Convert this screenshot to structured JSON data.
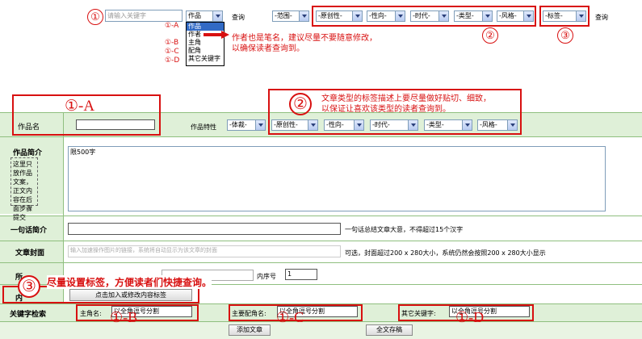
{
  "top_bar": {
    "search_placeholder": "请输入关键字",
    "type_select": "作品",
    "search_button": "查询",
    "scope_select": "-范围-",
    "filters": [
      "-原创性-",
      "-性向-",
      "-时代-",
      "-类型-",
      "-风格-"
    ],
    "tag_select": "-标签-",
    "search_button_2": "查询"
  },
  "dropdown": {
    "items": [
      "作品",
      "作者",
      "主角",
      "配角",
      "其它关键字"
    ],
    "side_labels": [
      "①-A",
      "①-B",
      "①-C",
      "①-D"
    ]
  },
  "annotations": {
    "num1": "①",
    "num2": "②",
    "num3": "③",
    "author_note_1": "作者也是笔名，建议尽量不要随意修改，",
    "author_note_2": "以确保读者查询到。",
    "big_a": "①-A",
    "big_num2": "②",
    "genre_note_1": "文章类型的标签描述上要尽量做好贴切、细致，",
    "genre_note_2": "以保证让喜欢该类型的读者查询到。",
    "big_num3": "③",
    "tag_note": "尽量设置标签，方便读者们快捷查询。",
    "label_b": "①-B",
    "label_c": "①-C",
    "label_d": "①-D"
  },
  "form": {
    "title_label": "作品名",
    "features_label": "作品特性",
    "feature_selects": [
      "-体裁-",
      "-原创性-",
      "-性向-",
      "-时代-",
      "-类型-",
      "-风格-"
    ],
    "intro_label": "作品简介",
    "intro_side_note": "这里只放作品文案，正文内容在后面步骤提交",
    "intro_placeholder": "限500字",
    "oneline_label": "一句话简介",
    "oneline_hint": "一句话总结文章大意，不得超过15个汉字",
    "cover_label": "文章封面",
    "cover_placeholder": "输入加速操作图片的链接，系统将自动显示为该文章的封面",
    "cover_hint": "可选，封面超过200 x 280大小，系统仍然会按照200 x 280大小显示",
    "series_label_partial": "所",
    "order_label": "内序号",
    "order_value": "1",
    "content_tag_label_partial": "内",
    "tag_button": "点击加入或修改内容标签",
    "keyword_label": "关键字检索",
    "protagonist_label": "主角名:",
    "protagonist_value": "以全角逗号分割",
    "supporting_label": "主要配角名:",
    "supporting_value": "以全角逗号分割",
    "other_label": "其它关键字:",
    "other_value": "以全角逗号分割",
    "save_detail_button": "添加文章",
    "save_all_button": "全文存稿"
  }
}
